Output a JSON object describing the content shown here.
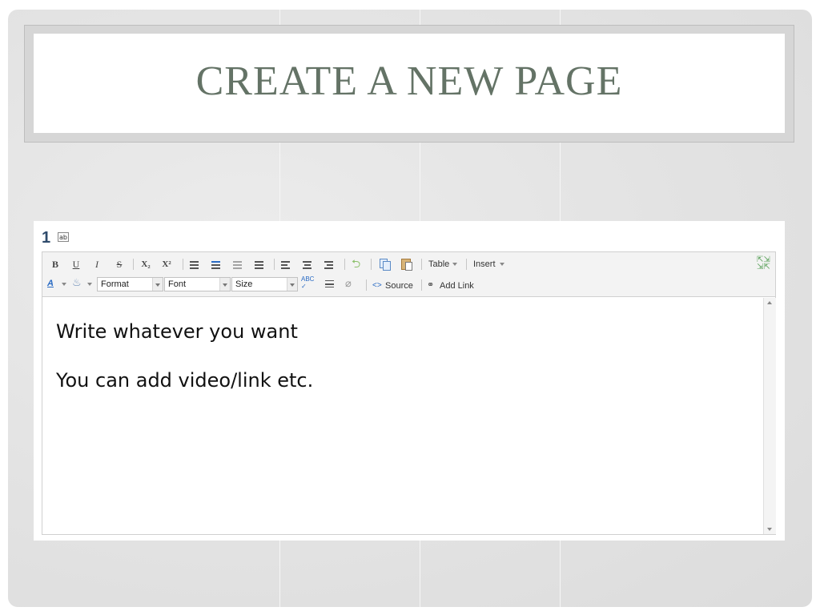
{
  "slide": {
    "title": "CREATE A NEW PAGE"
  },
  "editor": {
    "step_number": "1",
    "step_icon_text": "ab",
    "toolbar": {
      "row1": {
        "bold": "B",
        "underline": "U",
        "italic": "I",
        "strike": "S",
        "subscript": "X₂",
        "superscript": "X²",
        "table_label": "Table",
        "insert_label": "Insert"
      },
      "row2": {
        "format_value": "Format",
        "font_value": "Font",
        "size_value": "Size",
        "source_label": "Source",
        "add_link_label": "Add Link"
      },
      "icons": [
        "bulleted-list-icon",
        "numbered-list-icon",
        "outdent-icon",
        "indent-icon",
        "align-left-icon",
        "align-center-icon",
        "align-right-icon",
        "undo-icon",
        "copy-icon",
        "paste-icon",
        "maximize-icon",
        "text-color-icon",
        "background-color-icon",
        "spellcheck-icon",
        "horizontal-rule-icon",
        "remove-format-icon",
        "source-icon",
        "link-icon"
      ]
    },
    "content": {
      "line1": "Write whatever you want",
      "line2": "You can add video/link etc."
    }
  },
  "colors": {
    "title": "#647366",
    "step_number": "#2e4a6b",
    "source_icon": "#2a6bc4"
  }
}
